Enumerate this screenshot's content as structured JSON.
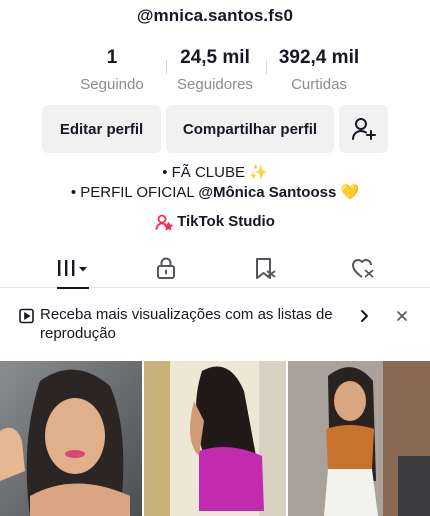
{
  "profile": {
    "username": "@mnica.santos.fs0"
  },
  "stats": {
    "following_count": "1",
    "following_label": "Seguindo",
    "followers_count": "24,5 mil",
    "followers_label": "Seguidores",
    "likes_count": "392,4 mil",
    "likes_label": "Curtidas"
  },
  "actions": {
    "edit_label": "Editar perfil",
    "share_label": "Compartilhar perfil",
    "add_friend_icon": "add-user-icon"
  },
  "bio": {
    "line1": "• FÃ CLUBE ✨",
    "line2_prefix": "• PERFIL OFICIAL ",
    "line2_tag": "@Mônica Santooss",
    "line2_emoji": " 💛",
    "studio_label": "TikTok Studio"
  },
  "tabs": [
    {
      "icon": "videos-grid-icon",
      "active": true
    },
    {
      "icon": "lock-icon",
      "active": false
    },
    {
      "icon": "saved-icon",
      "active": false
    },
    {
      "icon": "liked-icon",
      "active": false
    }
  ],
  "banner": {
    "text": "Receba mais visualizações com as listas de reprodução",
    "icon": "playlist-icon"
  },
  "colors": {
    "text": "#161823",
    "muted": "#8a8b91",
    "button_bg": "#f1f1f2",
    "studio_icon": "#fe2c55"
  }
}
